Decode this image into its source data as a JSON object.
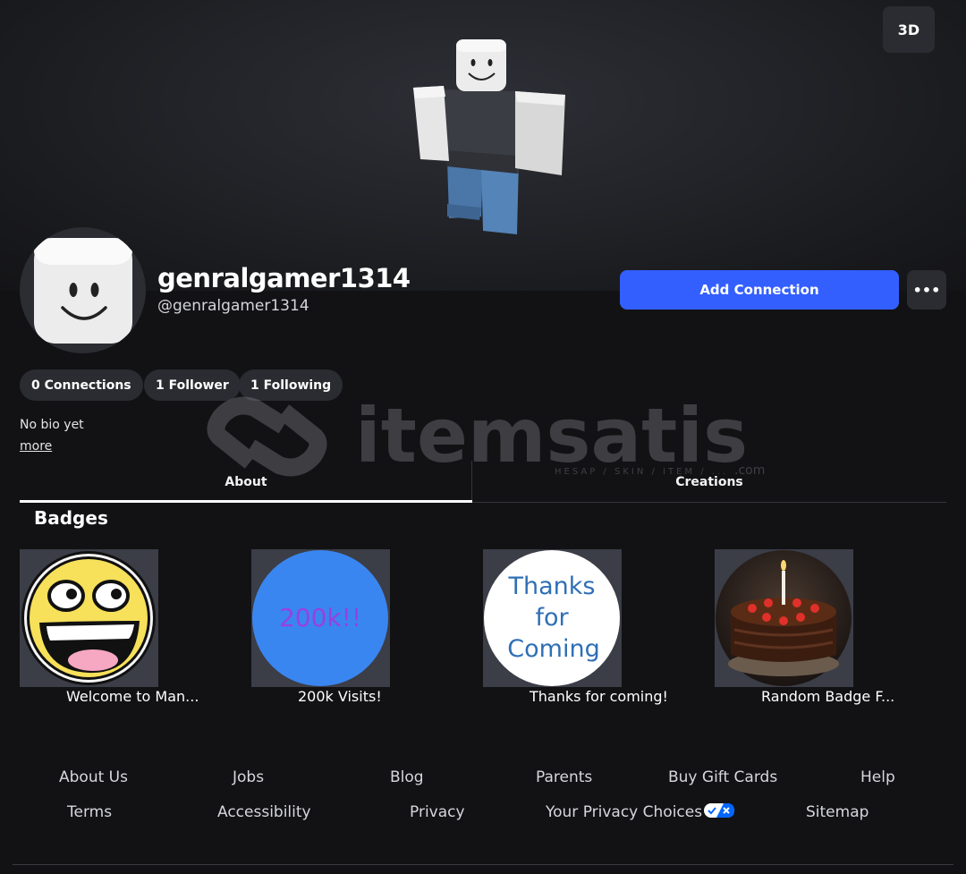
{
  "hero": {
    "view_toggle_label": "3D"
  },
  "profile": {
    "display_name": "genralgamer1314",
    "username": "@genralgamer1314",
    "add_connection_label": "Add Connection",
    "more_options_label": "•••",
    "stats": [
      {
        "label": "0 Connections"
      },
      {
        "label": "1 Follower"
      },
      {
        "label": "1 Following"
      }
    ],
    "bio": "No bio yet",
    "bio_more_label": "more"
  },
  "watermark": {
    "brand": "itemsatis",
    "tagline": "HESAP / SKIN / ITEM / ...",
    "suffix": ".com"
  },
  "tabs": [
    {
      "label": "About",
      "active": true
    },
    {
      "label": "Creations",
      "active": false
    }
  ],
  "badges": {
    "title": "Badges",
    "items": [
      {
        "name": "Welcome to Man...",
        "icon": "epic-face-icon"
      },
      {
        "name": "200k Visits!",
        "icon": "200k-badge-icon",
        "badge_text": "200k!!"
      },
      {
        "name": "Thanks for coming!",
        "icon": "thanks-badge-icon",
        "badge_lines": [
          "Thanks",
          "for",
          "Coming"
        ]
      },
      {
        "name": "Random Badge F...",
        "icon": "cake-badge-icon"
      }
    ]
  },
  "footer": {
    "row1": [
      "About Us",
      "Jobs",
      "Blog",
      "Parents",
      "Buy Gift Cards",
      "Help"
    ],
    "row2": [
      "Terms",
      "Accessibility",
      "Privacy",
      "Your Privacy Choices",
      "Sitemap"
    ]
  },
  "colors": {
    "accent": "#335fff",
    "background": "#121215",
    "pill": "#2b2c31"
  }
}
